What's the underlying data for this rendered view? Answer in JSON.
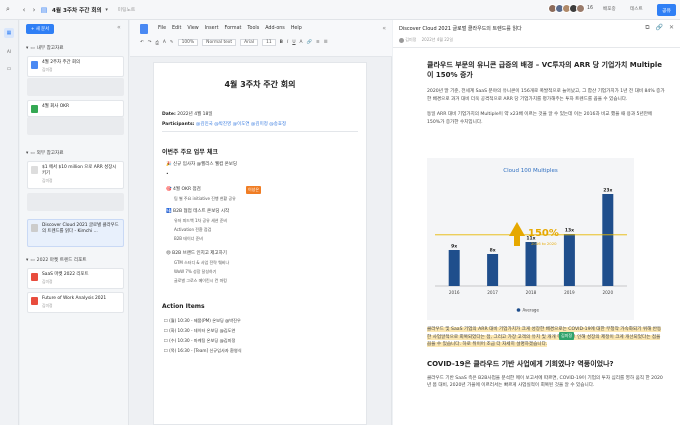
{
  "topbar": {
    "title": "4월 3주차 주간 회의",
    "breadcrumb": "미팅노트",
    "count": "16",
    "btn1": "배포중",
    "btn2": "테스트",
    "share": "공유"
  },
  "sidebar": {
    "new_button": "+ 새 문서",
    "sections": [
      {
        "title": "내부 참고자료"
      },
      {
        "title": "외부 참고자료"
      },
      {
        "title": "2022 마켓 트렌드 리포트"
      }
    ],
    "items": [
      {
        "title": "4월 2주차 주간 회의",
        "sub": "김미정"
      },
      {
        "title": "4월 회사 OKR",
        "sub": ""
      },
      {
        "title": "$1 에서 $10 million 으로 ARR 성장시키기",
        "sub": "김미정"
      },
      {
        "title": "Discover Cloud 2021 글로벌 클라우드의 트렌드를 읽다 - Kimchi ...",
        "sub": "김미정"
      },
      {
        "title": "SaaS 마켓 2022 리포트",
        "sub": "김미정"
      },
      {
        "title": "Future of Work Analysis 2021",
        "sub": "김미정"
      }
    ]
  },
  "editor": {
    "menu": [
      "File",
      "Edit",
      "View",
      "Insert",
      "Format",
      "Tools",
      "Add-ons",
      "Help"
    ],
    "toolbar": {
      "zoom": "100%",
      "style": "Normal text",
      "font": "Arial",
      "size": "11"
    },
    "doc_title": "4월 3주차 주간 회의",
    "date_label": "Date:",
    "date_value": "2022년 4월 18일",
    "participants_label": "Participants:",
    "participants": "@김민국 @박진영 @이도연 @김미정 @송효정",
    "section1": "이번주 주요 업무 체크",
    "b1": "🎉 신규 입사자 @헬리스 웰컴 온보딩",
    "b2": "🎯 4월 OKR 점검",
    "b2a": "팀 별 주요 initiative 진행 현황 공유",
    "b3": "🛂 B2B 협업 테스트 온보딩 시작",
    "b3a": "유저 피드백 1차 공유 세션 준비",
    "b3b": "Activation 전환 점검",
    "b3c": "B2B 테이너 준비",
    "b4": "😄 B2B 브랜드 인지고 제고하기",
    "b4a": "GTM 스터디 & 사업 전략 웨비나",
    "b4b": "WoW 7% 성장 달성하기",
    "b4c": "글로벌 그로스 메이킨시 컨 마킹",
    "cursor_tag": "이성은",
    "section2": "Action Items",
    "actions": [
      "(월) 10:30 - 제품(PM) 온보딩 @박진우",
      "(화) 10:30 - 데이터 온보딩 @김도연",
      "(수) 10:30 - 마케팅 온보딩 @김미정",
      "(목) 16:30 - [Team] 신규입사자 환영식"
    ]
  },
  "viewer": {
    "title": "Discover Cloud 2021 글로벌 클라우드의 트렌드를 읽다",
    "author": "김미정",
    "date": "2022년 4월 22일",
    "heading1": "클라우드 부문의 유니콘 급증의 배경 – VC투자의 ARR 당 기업가치 Multiple이 150% 증가",
    "para1": "2020년 말 기준, 전세계 SaaS 분야의 유니콘이 156개로 폭발적으로 늘어났고, 그 합산 기업가치가 1년 전 대비 84% 증가한 배경으로 과거 대비 더욱 공격적으로 ARR 당 기업가치를 평가해주는 투자 트렌드를 꼽을 수 있습니다.",
    "para2": "동일 ARR 대비 기업가치의 Multiple이 약 x23배 이르는 것을 알 수 있는데 이는 2016과 비교 했을 때 용과 5년만에 150%가 증가한 수치입니다.",
    "para3": "클라우드 및 SaaS 기업의 ARR 대비 기업가치가 크게 성장한 배경으로는 COVID-19에 대한 무청작 가속화되기 위해 반등한 사업알적으로 회복되었다는 점, 그리고 가장 고객의 유치 및 개개 핵 증가로 인해 성장의 제정이 크게 개선되었다는 점을 꼽을 수 있습니다. 하로 뒤이어 조금 더 자세히 설명하겠습니다.",
    "cursor_tag": "김미정",
    "heading2": "COVID-19은 클라우드 기반 사업에게 기회였나? 역풍이었나?",
    "para4": "클라우드 기반 SaaS 측은 B2B사업을 분석한 메이 보고서에 따르면, COVID-19이 기업의 투자 심리를 영하 움직 한 2020년 봄 대비, 2020년 가을에 이르러서는 빠르게 사업실적이 회복된 것을 알 수 있습니다."
  },
  "chart_data": {
    "type": "bar",
    "title": "Cloud 100 Multiples",
    "categories": [
      "2016",
      "2017",
      "2018",
      "2019",
      "2020"
    ],
    "values": [
      9,
      8,
      11,
      13,
      23
    ],
    "value_labels": [
      "9x",
      "8x",
      "11x",
      "13x",
      "23x"
    ],
    "callout": "150%",
    "callout_sub": "2016 to 2020",
    "legend": "Average",
    "bar_color": "#1f4e8c",
    "bg_color": "#f4f5f7",
    "avg_line_color": "#e6b800"
  }
}
